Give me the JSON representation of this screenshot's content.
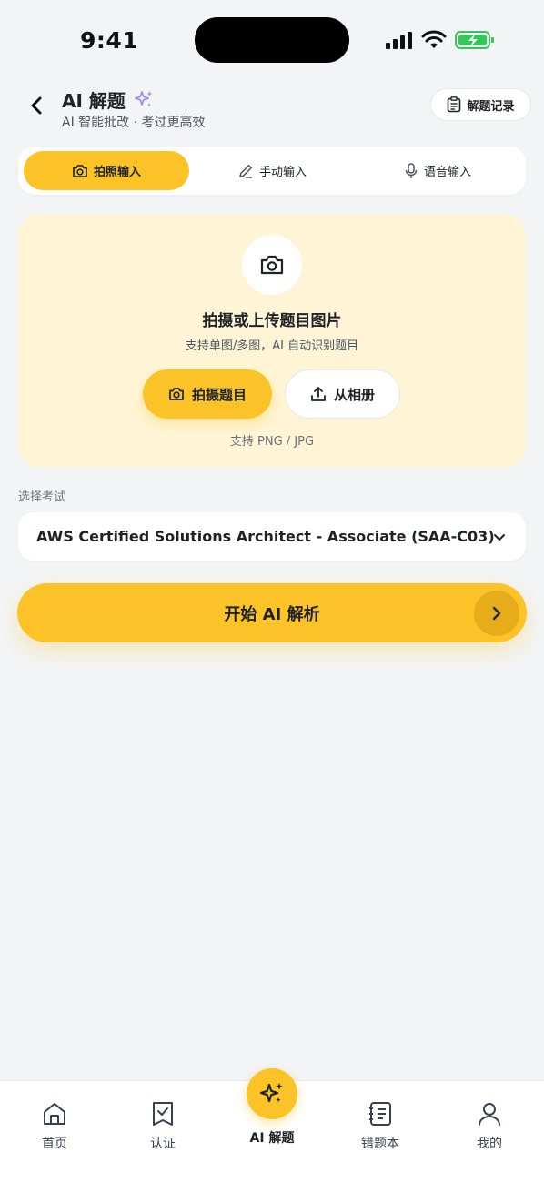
{
  "status_bar": {
    "time": "9:41"
  },
  "header": {
    "title": "AI 解题",
    "subtitle": "AI 智能批改 · 考过更高效",
    "history_label": "解题记录"
  },
  "tabs": [
    {
      "label": "拍照输入",
      "icon": "camera-icon",
      "active": true
    },
    {
      "label": "手动输入",
      "icon": "pencil-icon",
      "active": false
    },
    {
      "label": "语音输入",
      "icon": "microphone-icon",
      "active": false
    }
  ],
  "upload": {
    "title": "拍摄或上传题目图片",
    "subtitle": "支持单图/多图，AI 自动识别题目",
    "take_label": "拍摄题目",
    "album_label": "从相册",
    "note": "支持 PNG / JPG"
  },
  "exam": {
    "label": "选择考试",
    "selected": "AWS Certified Solutions Architect - Associate (SAA-C03)"
  },
  "start_label": "开始 AI 解析",
  "bottom_nav": [
    {
      "label": "首页",
      "icon": "home-icon"
    },
    {
      "label": "认证",
      "icon": "certificate-icon"
    },
    {
      "label": "AI 解题",
      "icon": "sparkles-icon",
      "active": true
    },
    {
      "label": "错题本",
      "icon": "notebook-icon"
    },
    {
      "label": "我的",
      "icon": "user-icon"
    }
  ],
  "colors": {
    "accent": "#fbc327",
    "background": "#f3f4f6",
    "card_tint": "#fff5d6",
    "sparkle": "#a78bfa",
    "battery": "#34c759"
  }
}
